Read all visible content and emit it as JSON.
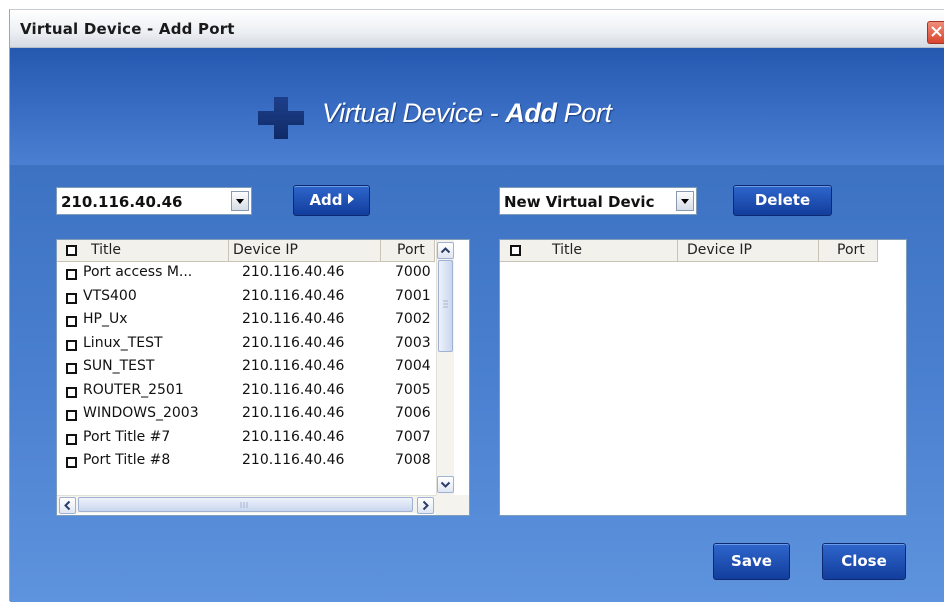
{
  "window": {
    "title": "Virtual Device - Add Port"
  },
  "banner": {
    "title_normal": "Virtual Device - ",
    "title_bold": "Add",
    "title_tail": " Port"
  },
  "left": {
    "device_select": {
      "value": "210.116.40.46"
    },
    "add_label": "Add",
    "columns": [
      "Title",
      "Device IP",
      "Port"
    ],
    "rows": [
      {
        "title": "Port access M...",
        "ip": "210.116.40.46",
        "port": "7000"
      },
      {
        "title": "VTS400",
        "ip": "210.116.40.46",
        "port": "7001"
      },
      {
        "title": "HP_Ux",
        "ip": "210.116.40.46",
        "port": "7002"
      },
      {
        "title": "Linux_TEST",
        "ip": "210.116.40.46",
        "port": "7003"
      },
      {
        "title": "SUN_TEST",
        "ip": "210.116.40.46",
        "port": "7004"
      },
      {
        "title": "ROUTER_2501",
        "ip": "210.116.40.46",
        "port": "7005"
      },
      {
        "title": "WINDOWS_2003",
        "ip": "210.116.40.46",
        "port": "7006"
      },
      {
        "title": "Port Title #7",
        "ip": "210.116.40.46",
        "port": "7007"
      },
      {
        "title": "Port Title #8",
        "ip": "210.116.40.46",
        "port": "7008"
      }
    ]
  },
  "right": {
    "device_select": {
      "value": "New Virtual Devic"
    },
    "delete_label": "Delete",
    "columns": [
      "Title",
      "Device IP",
      "Port"
    ],
    "rows": []
  },
  "footer": {
    "save_label": "Save",
    "close_label": "Close"
  },
  "colors": {
    "banner_blue": "#2559b0",
    "body_blue": "#4b80d0",
    "button_blue": "#123d9c",
    "close_red": "#d8452c"
  }
}
